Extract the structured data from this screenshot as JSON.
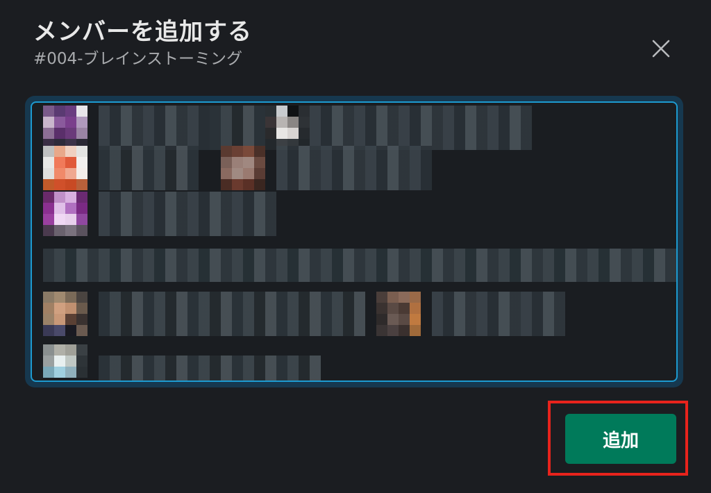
{
  "dialog": {
    "title": "メンバーを追加する",
    "subtitle": "#004-ブレインストーミング",
    "close_icon": "close-icon",
    "add_button_label": "追加"
  },
  "colors": {
    "background": "#1b1d21",
    "input_focus_border": "#1d9bd1",
    "primary_button": "#007a5a",
    "annotation_highlight": "#e8231c"
  }
}
